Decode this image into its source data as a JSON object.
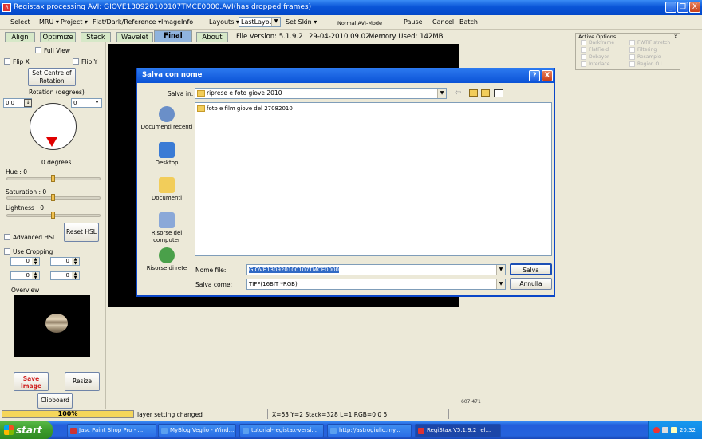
{
  "window": {
    "title": "Registax processing AVI: GIOVE130920100107TMCE0000.AVI(has dropped frames)",
    "controls": [
      "_",
      "❐",
      "X"
    ]
  },
  "menu": {
    "select": "Select",
    "mru": "MRU ▾",
    "project": "Project ▾",
    "flat": "Flat/Dark/Reference ▾",
    "imageinfo": "ImageInfo",
    "layouts": "Layouts ▾",
    "layout_value": "LastLayout",
    "set_skin": "Set Skin ▾",
    "avi_mode": "Normal AVI-Mode",
    "pause": "Pause",
    "cancel": "Cancel",
    "batch": "Batch"
  },
  "tabs": [
    {
      "label": "Align"
    },
    {
      "label": "Optimize"
    },
    {
      "label": "Stack"
    },
    {
      "label": "Wavelet"
    },
    {
      "label": "Final"
    },
    {
      "label": "About"
    }
  ],
  "info": {
    "version": "File Version: 5.1.9.2",
    "date": "29-04-2010 09.02",
    "memory": "Memory Used: 142MB"
  },
  "left": {
    "full_view": "Full View",
    "flip_x": "Flip X",
    "flip_y": "Flip Y",
    "set_centre": "Set Centre of Rotation",
    "rotation_label": "Rotation (degrees)",
    "rotation_value": "0,0",
    "rotation_combo": "0",
    "rotation_readout": "0 degrees",
    "hue": "Hue : 0",
    "saturation": "Saturation : 0",
    "lightness": "Lightness : 0",
    "advanced_hsl": "Advanced HSL",
    "reset_hsl": "Reset HSL",
    "use_cropping": "Use Cropping",
    "crop_values": [
      "0",
      "0",
      "0",
      "0"
    ],
    "overview": "Overview",
    "save_image": "Save Image",
    "resize": "Resize",
    "clipboard": "Clipboard"
  },
  "active_options": {
    "title": "Active Options",
    "close": "X",
    "items": [
      "Darkframe",
      "FlatField",
      "Debayer",
      "Interlace",
      "FWTIF stretch",
      "Filtering",
      "Resample",
      "Region O.I."
    ]
  },
  "dialog": {
    "title": "Salva con nome",
    "help": "?",
    "close": "X",
    "save_in_label": "Salva in:",
    "save_in_value": "riprese  e foto giove 2010",
    "places": [
      "Documenti recenti",
      "Desktop",
      "Documenti",
      "Risorse del computer",
      "Risorse di rete"
    ],
    "files": [
      "foto e film giove del 27082010"
    ],
    "filename_label": "Nome file:",
    "filename_value": "GIOVE130920100107TMCE0000",
    "savetype_label": "Salva come:",
    "savetype_value": "TIFF(16BIT *RGB)",
    "save_button": "Salva",
    "cancel_button": "Annulla"
  },
  "coords_text": "607,471",
  "status": {
    "progress_label": "100%",
    "progress": 1.0,
    "message": "layer setting changed",
    "readout": "X=63 Y=2 Stack=328 L=1 RGB=0 0 5"
  },
  "taskbar": {
    "start": "start",
    "items": [
      {
        "label": "Jasc Paint Shop Pro - ..."
      },
      {
        "label": "MyBlog Veglio - Wind..."
      },
      {
        "label": "tutorial-registax-versi..."
      },
      {
        "label": "http://astrogiulio.my..."
      },
      {
        "label": "RegiStax V5.1.9.2 rel..."
      }
    ],
    "clock": "20.32"
  },
  "colors": {
    "titlebar": "#0a55d8",
    "window_bg": "#ECE9D8",
    "active_tab": "#8fb4de",
    "taskbar": "#245edb",
    "start": "#3c9c2c",
    "progress": "#f5d65a",
    "save_image_text": "#d02020"
  }
}
